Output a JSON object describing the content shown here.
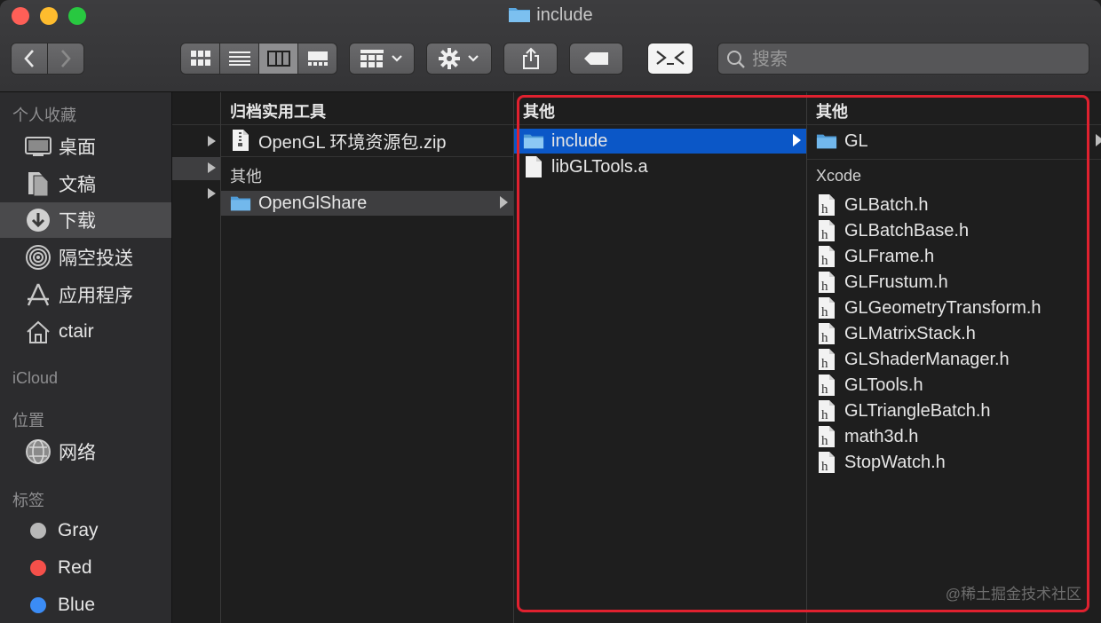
{
  "window": {
    "title": "include"
  },
  "toolbar": {
    "search_placeholder": "搜索",
    "colors": {
      "active_segment": "#8e8e90",
      "button": "#5f5f61"
    }
  },
  "sidebar": {
    "favorites_header": "个人收藏",
    "favorites": [
      {
        "label": "桌面",
        "icon": "desktop-icon"
      },
      {
        "label": "文稿",
        "icon": "documents-icon"
      },
      {
        "label": "下载",
        "icon": "downloads-icon",
        "selected": true
      },
      {
        "label": "隔空投送",
        "icon": "airdrop-icon"
      },
      {
        "label": "应用程序",
        "icon": "applications-icon"
      },
      {
        "label": "ctair",
        "icon": "home-icon"
      }
    ],
    "icloud_header": "iCloud",
    "locations_header": "位置",
    "locations": [
      {
        "label": "网络",
        "icon": "network-icon"
      }
    ],
    "tags_header": "标签",
    "tags": [
      {
        "label": "Gray",
        "color": "#b8b8b8"
      },
      {
        "label": "Red",
        "color": "#f5504a"
      },
      {
        "label": "Blue",
        "color": "#3b8cf5"
      }
    ]
  },
  "columns": {
    "col1": {
      "group1": "归档实用工具",
      "item_zip": "OpenGL 环境资源包.zip",
      "group2": "其他",
      "item_share": "OpenGlShare"
    },
    "col2": {
      "header": "其他",
      "items": [
        {
          "name": "include",
          "kind": "folder",
          "selected": true
        },
        {
          "name": "libGLTools.a",
          "kind": "file"
        }
      ]
    },
    "col3": {
      "header": "其他",
      "folder": "GL",
      "group": "Xcode",
      "files": [
        "GLBatch.h",
        "GLBatchBase.h",
        "GLFrame.h",
        "GLFrustum.h",
        "GLGeometryTransform.h",
        "GLMatrixStack.h",
        "GLShaderManager.h",
        "GLTools.h",
        "GLTriangleBatch.h",
        "math3d.h",
        "StopWatch.h"
      ]
    }
  },
  "annotation_color": "#e0212f",
  "watermark": "@稀土掘金技术社区"
}
